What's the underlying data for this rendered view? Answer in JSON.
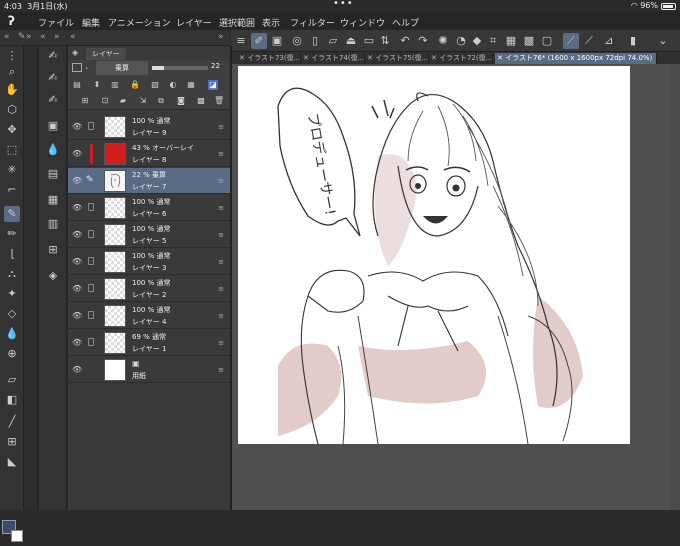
{
  "status": {
    "time": "4:03",
    "date": "3月1日(水)",
    "dots": "•••",
    "battery": "96%"
  },
  "menu": [
    "ファイル",
    "編集",
    "アニメーション",
    "レイヤー",
    "選択範囲",
    "表示",
    "フィルター",
    "ウィンドウ",
    "ヘルプ"
  ],
  "tabs": [
    "イラスト73(復...",
    "イラスト74(復...",
    "イラスト75(復...",
    "イラスト72(復...",
    "イラスト76* (1600 x 1600px 72dpi 74.0%)"
  ],
  "layer_panel": {
    "title": "レイヤー",
    "blend_mode": "乗算",
    "opacity": "22"
  },
  "layers": [
    {
      "mode": "100 % 通常",
      "name": "レイヤー 9",
      "thumb": "clear"
    },
    {
      "mode": "43 % オーバーレイ",
      "name": "レイヤー 8",
      "thumb": "red"
    },
    {
      "mode": "22 % 乗算",
      "name": "レイヤー 7",
      "thumb": "sketch"
    },
    {
      "mode": "100 % 通常",
      "name": "レイヤー 6",
      "thumb": "clear"
    },
    {
      "mode": "100 % 通常",
      "name": "レイヤー 5",
      "thumb": "clear"
    },
    {
      "mode": "100 % 通常",
      "name": "レイヤー 3",
      "thumb": "clear"
    },
    {
      "mode": "100 % 通常",
      "name": "レイヤー 2",
      "thumb": "clear"
    },
    {
      "mode": "100 % 通常",
      "name": "レイヤー 4",
      "thumb": "clear"
    },
    {
      "mode": "69 % 通常",
      "name": "レイヤー 1",
      "thumb": "clear"
    },
    {
      "mode": "",
      "name": "用紙",
      "thumb": "white"
    }
  ],
  "canvas": {
    "speech_text": "プロデューサー!"
  },
  "colors": {
    "accent": "#5a6b85",
    "overlay_red": "#d21d1d",
    "shadow_pink": "#e2ccc9"
  }
}
